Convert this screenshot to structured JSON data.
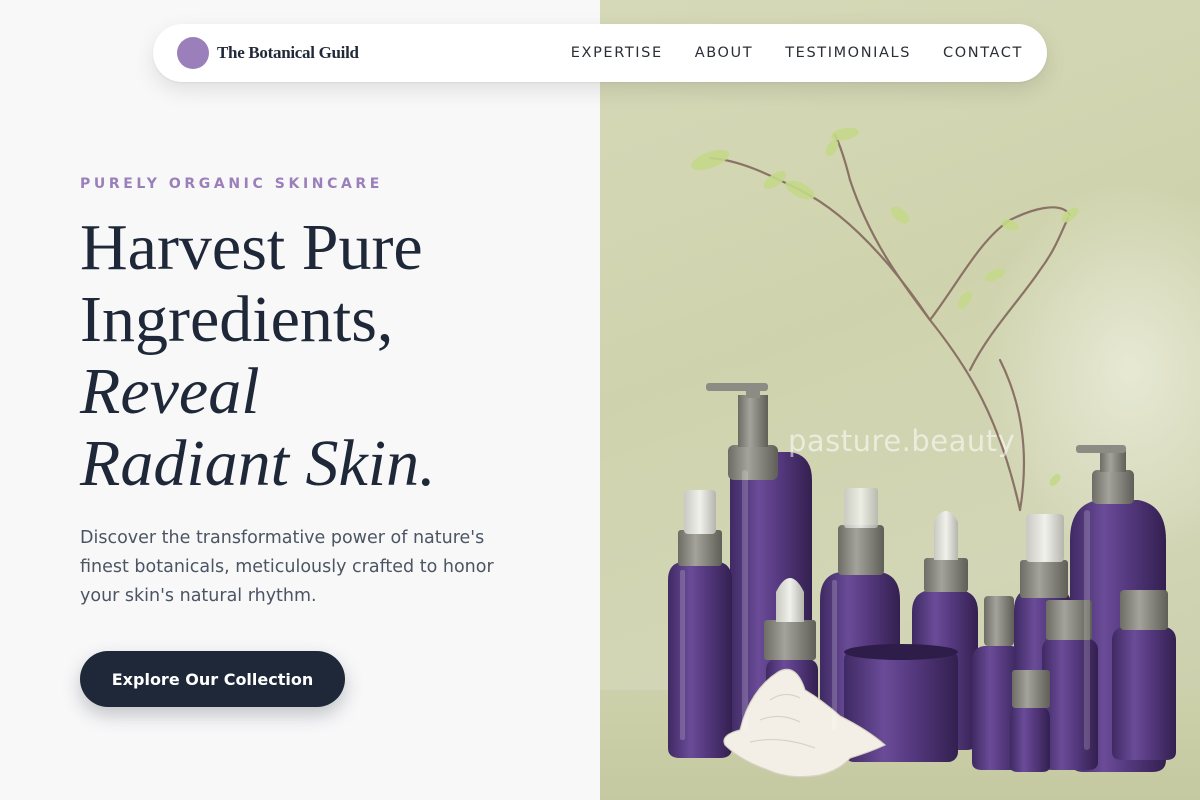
{
  "header": {
    "brand_name": "The Botanical Guild",
    "logo_color": "#9a7fbb",
    "nav": [
      {
        "label": "EXPERTISE"
      },
      {
        "label": "ABOUT"
      },
      {
        "label": "TESTIMONIALS"
      },
      {
        "label": "CONTACT"
      }
    ]
  },
  "hero": {
    "eyebrow": "PURELY ORGANIC SKINCARE",
    "headline": {
      "line1": "Harvest Pure",
      "line2": "Ingredients,",
      "line3": "Reveal",
      "line4": "Radiant Skin."
    },
    "description": "Discover the transformative power of nature's finest botanicals, meticulously crafted to honor your skin's natural rhythm.",
    "cta_label": "Explore Our Collection"
  },
  "image": {
    "watermark": "pasture.beauty"
  },
  "colors": {
    "accent": "#9a7fbb",
    "dark": "#1e2838",
    "background": "#f8f8f9",
    "image_bg": "#d3d6b6",
    "bottle_purple": "#5c3f86"
  }
}
